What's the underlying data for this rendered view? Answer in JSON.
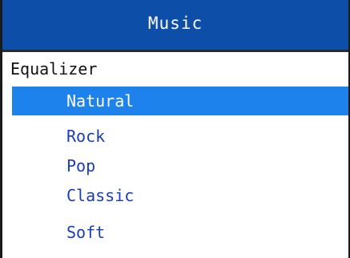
{
  "window": {
    "title": "Music"
  },
  "equalizer": {
    "header": "Equalizer",
    "selected": "Natural",
    "options": [
      "Natural",
      "Rock",
      "Pop",
      "Classic",
      "Soft"
    ]
  },
  "colors": {
    "titlebar": "#0d4ea8",
    "selection": "#1e82ec",
    "item_text": "#1a3db8"
  }
}
